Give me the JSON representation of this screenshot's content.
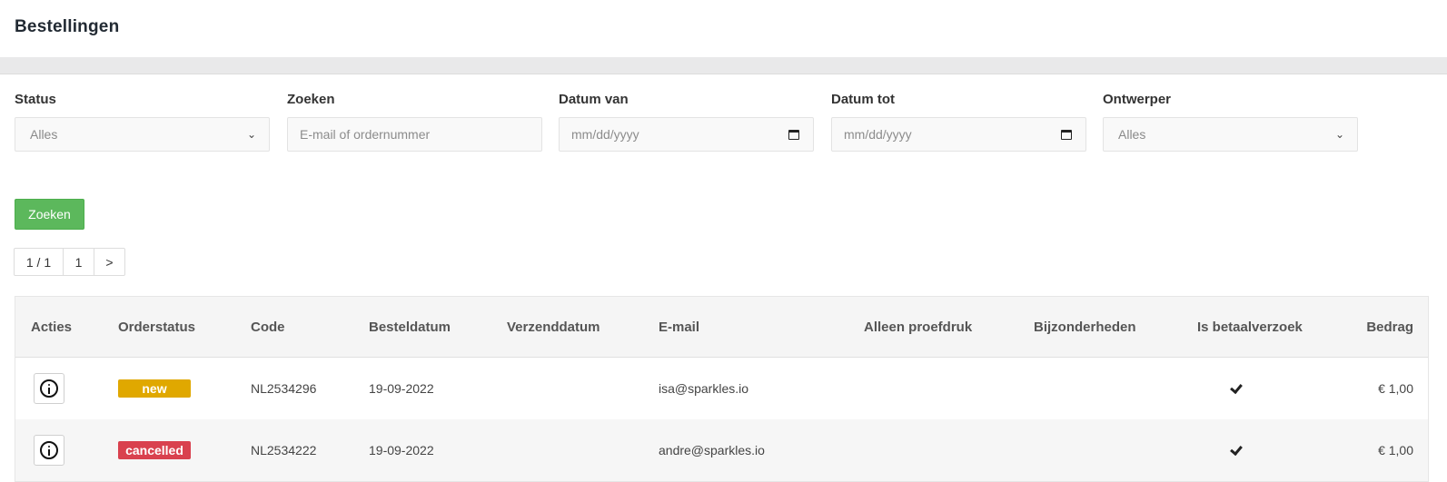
{
  "header": {
    "title": "Bestellingen"
  },
  "filters": {
    "status": {
      "label": "Status",
      "value": "Alles"
    },
    "search": {
      "label": "Zoeken",
      "placeholder": "E-mail of ordernummer"
    },
    "date_from": {
      "label": "Datum van",
      "placeholder": "mm/dd/yyyy"
    },
    "date_to": {
      "label": "Datum tot",
      "placeholder": "mm/dd/yyyy"
    },
    "designer": {
      "label": "Ontwerper",
      "value": "Alles"
    },
    "search_button": "Zoeken"
  },
  "pagination": {
    "summary": "1 / 1",
    "page": "1",
    "next": ">"
  },
  "table": {
    "columns": [
      "Acties",
      "Orderstatus",
      "Code",
      "Besteldatum",
      "Verzenddatum",
      "E-mail",
      "Alleen proefdruk",
      "Bijzonderheden",
      "Is betaalverzoek",
      "Bedrag"
    ],
    "rows": [
      {
        "status": "new",
        "status_color": "#e0a800",
        "code": "NL2534296",
        "order_date": "19-09-2022",
        "ship_date": "",
        "email": "isa@sparkles.io",
        "proof_only": "",
        "details": "",
        "payment_request": true,
        "amount": "€ 1,00"
      },
      {
        "status": "cancelled",
        "status_color": "#d9414e",
        "code": "NL2534222",
        "order_date": "19-09-2022",
        "ship_date": "",
        "email": "andre@sparkles.io",
        "proof_only": "",
        "details": "",
        "payment_request": true,
        "amount": "€ 1,00"
      }
    ]
  },
  "icons": {
    "row_action": "info-icon",
    "payment_request": "check-icon",
    "dropdown": "chevron-down-icon",
    "date": "calendar-icon"
  },
  "colors": {
    "primary_button": "#5cb85c",
    "new": "#e0a800",
    "cancelled": "#d9414e"
  }
}
